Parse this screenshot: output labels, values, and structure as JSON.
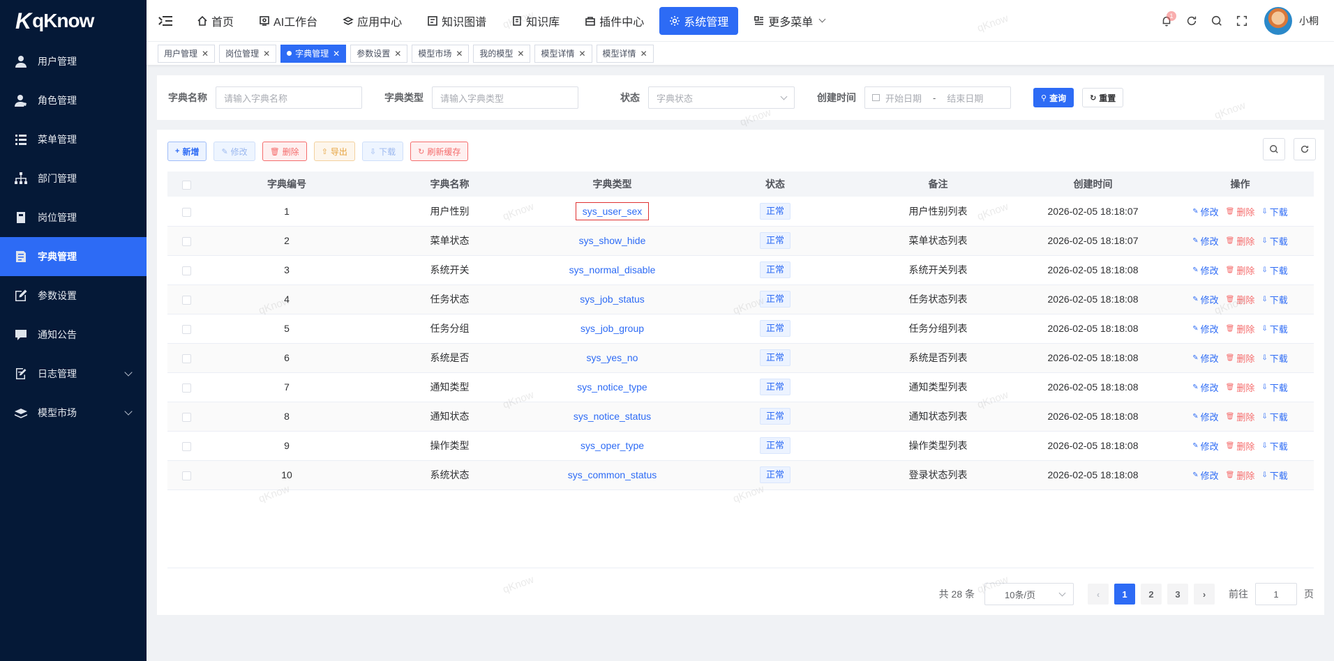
{
  "app": {
    "logo_text": "qKnow",
    "logo_mark": "K"
  },
  "sidebar": {
    "items": [
      {
        "label": "用户管理",
        "icon": "user-icon"
      },
      {
        "label": "角色管理",
        "icon": "role-icon"
      },
      {
        "label": "菜单管理",
        "icon": "menu-list-icon"
      },
      {
        "label": "部门管理",
        "icon": "org-tree-icon"
      },
      {
        "label": "岗位管理",
        "icon": "post-icon"
      },
      {
        "label": "字典管理",
        "icon": "dict-icon",
        "active": true
      },
      {
        "label": "参数设置",
        "icon": "edit-params-icon"
      },
      {
        "label": "通知公告",
        "icon": "message-icon"
      },
      {
        "label": "日志管理",
        "icon": "log-icon",
        "expandable": true
      },
      {
        "label": "模型市场",
        "icon": "model-icon",
        "expandable": true
      }
    ]
  },
  "topnav": {
    "items": [
      {
        "label": "首页",
        "icon": "home-icon"
      },
      {
        "label": "AI工作台",
        "icon": "ai-icon"
      },
      {
        "label": "应用中心",
        "icon": "app-icon"
      },
      {
        "label": "知识图谱",
        "icon": "graph-icon"
      },
      {
        "label": "知识库",
        "icon": "book-icon"
      },
      {
        "label": "插件中心",
        "icon": "plugin-icon"
      },
      {
        "label": "系统管理",
        "icon": "gear-icon",
        "active": true
      },
      {
        "label": "更多菜单",
        "icon": "more-icon",
        "dropdown": true
      }
    ],
    "notification_count": "1",
    "username": "小桐"
  },
  "tags": [
    {
      "label": "用户管理"
    },
    {
      "label": "岗位管理"
    },
    {
      "label": "字典管理",
      "active": true
    },
    {
      "label": "参数设置"
    },
    {
      "label": "模型市场"
    },
    {
      "label": "我的模型"
    },
    {
      "label": "模型详情"
    },
    {
      "label": "模型详情"
    }
  ],
  "search": {
    "dict_name_label": "字典名称",
    "dict_name_placeholder": "请输入字典名称",
    "dict_type_label": "字典类型",
    "dict_type_placeholder": "请输入字典类型",
    "status_label": "状态",
    "status_placeholder": "字典状态",
    "created_label": "创建时间",
    "start_placeholder": "开始日期",
    "range_sep": "-",
    "end_placeholder": "结束日期",
    "query_button": "查询",
    "reset_button": "重置"
  },
  "toolbar": {
    "add": "新增",
    "edit": "修改",
    "delete": "删除",
    "export": "导出",
    "download": "下载",
    "refresh_cache": "刷新缓存"
  },
  "table": {
    "headers": [
      "字典编号",
      "字典名称",
      "字典类型",
      "状态",
      "备注",
      "创建时间",
      "操作"
    ],
    "op_edit": "修改",
    "op_delete": "删除",
    "op_download": "下载",
    "rows": [
      {
        "id": "1",
        "name": "用户性别",
        "type": "sys_user_sex",
        "status": "正常",
        "remark": "用户性别列表",
        "created": "2026-02-05 18:18:07",
        "highlight": true
      },
      {
        "id": "2",
        "name": "菜单状态",
        "type": "sys_show_hide",
        "status": "正常",
        "remark": "菜单状态列表",
        "created": "2026-02-05 18:18:07"
      },
      {
        "id": "3",
        "name": "系统开关",
        "type": "sys_normal_disable",
        "status": "正常",
        "remark": "系统开关列表",
        "created": "2026-02-05 18:18:08"
      },
      {
        "id": "4",
        "name": "任务状态",
        "type": "sys_job_status",
        "status": "正常",
        "remark": "任务状态列表",
        "created": "2026-02-05 18:18:08"
      },
      {
        "id": "5",
        "name": "任务分组",
        "type": "sys_job_group",
        "status": "正常",
        "remark": "任务分组列表",
        "created": "2026-02-05 18:18:08"
      },
      {
        "id": "6",
        "name": "系统是否",
        "type": "sys_yes_no",
        "status": "正常",
        "remark": "系统是否列表",
        "created": "2026-02-05 18:18:08"
      },
      {
        "id": "7",
        "name": "通知类型",
        "type": "sys_notice_type",
        "status": "正常",
        "remark": "通知类型列表",
        "created": "2026-02-05 18:18:08"
      },
      {
        "id": "8",
        "name": "通知状态",
        "type": "sys_notice_status",
        "status": "正常",
        "remark": "通知状态列表",
        "created": "2026-02-05 18:18:08"
      },
      {
        "id": "9",
        "name": "操作类型",
        "type": "sys_oper_type",
        "status": "正常",
        "remark": "操作类型列表",
        "created": "2026-02-05 18:18:08"
      },
      {
        "id": "10",
        "name": "系统状态",
        "type": "sys_common_status",
        "status": "正常",
        "remark": "登录状态列表",
        "created": "2026-02-05 18:18:08"
      }
    ]
  },
  "pagination": {
    "total_text": "共 28 条",
    "page_size": "10条/页",
    "pages": [
      "1",
      "2",
      "3"
    ],
    "current": "1",
    "goto_label": "前往",
    "goto_value": "1",
    "page_suffix": "页"
  },
  "watermark": "qKnow",
  "colors": {
    "primary": "#2d6bf5",
    "sidebar_bg": "#051937",
    "danger": "#f56c6c",
    "warning": "#e6a23c"
  }
}
